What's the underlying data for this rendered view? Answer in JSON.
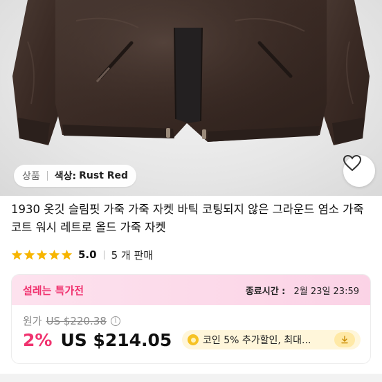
{
  "product": {
    "category_label": "상품",
    "color_label": "색상:",
    "color_value": "Rust Red",
    "title": "1930 옷깃 슬림핏 가죽 가죽 자켓 바틱 코팅되지 않은 그라운드 염소 가죽 코트 워시 레트로 올드 가죽 자켓"
  },
  "rating": {
    "score": "5.0",
    "star_count": 5,
    "sold": "5 개 판매"
  },
  "deal": {
    "name": "설레는 특가전",
    "end_label": "종료시간 :",
    "end_time": "2월 23일 23:59",
    "original_label": "원가",
    "original_price": "US $220.38",
    "discount": "2%",
    "price": "US $214.05",
    "coin_text": "코인 5% 추가할인, 최대..."
  },
  "icons": {
    "wishlist": "heart-outline-icon",
    "info": "info-icon",
    "coin": "coin-icon",
    "download": "download-arrow-icon",
    "star": "star-icon"
  },
  "colors": {
    "accent_pink": "#f0336f",
    "star_yellow": "#f7b500",
    "jacket_brown": "#3a2a24"
  }
}
